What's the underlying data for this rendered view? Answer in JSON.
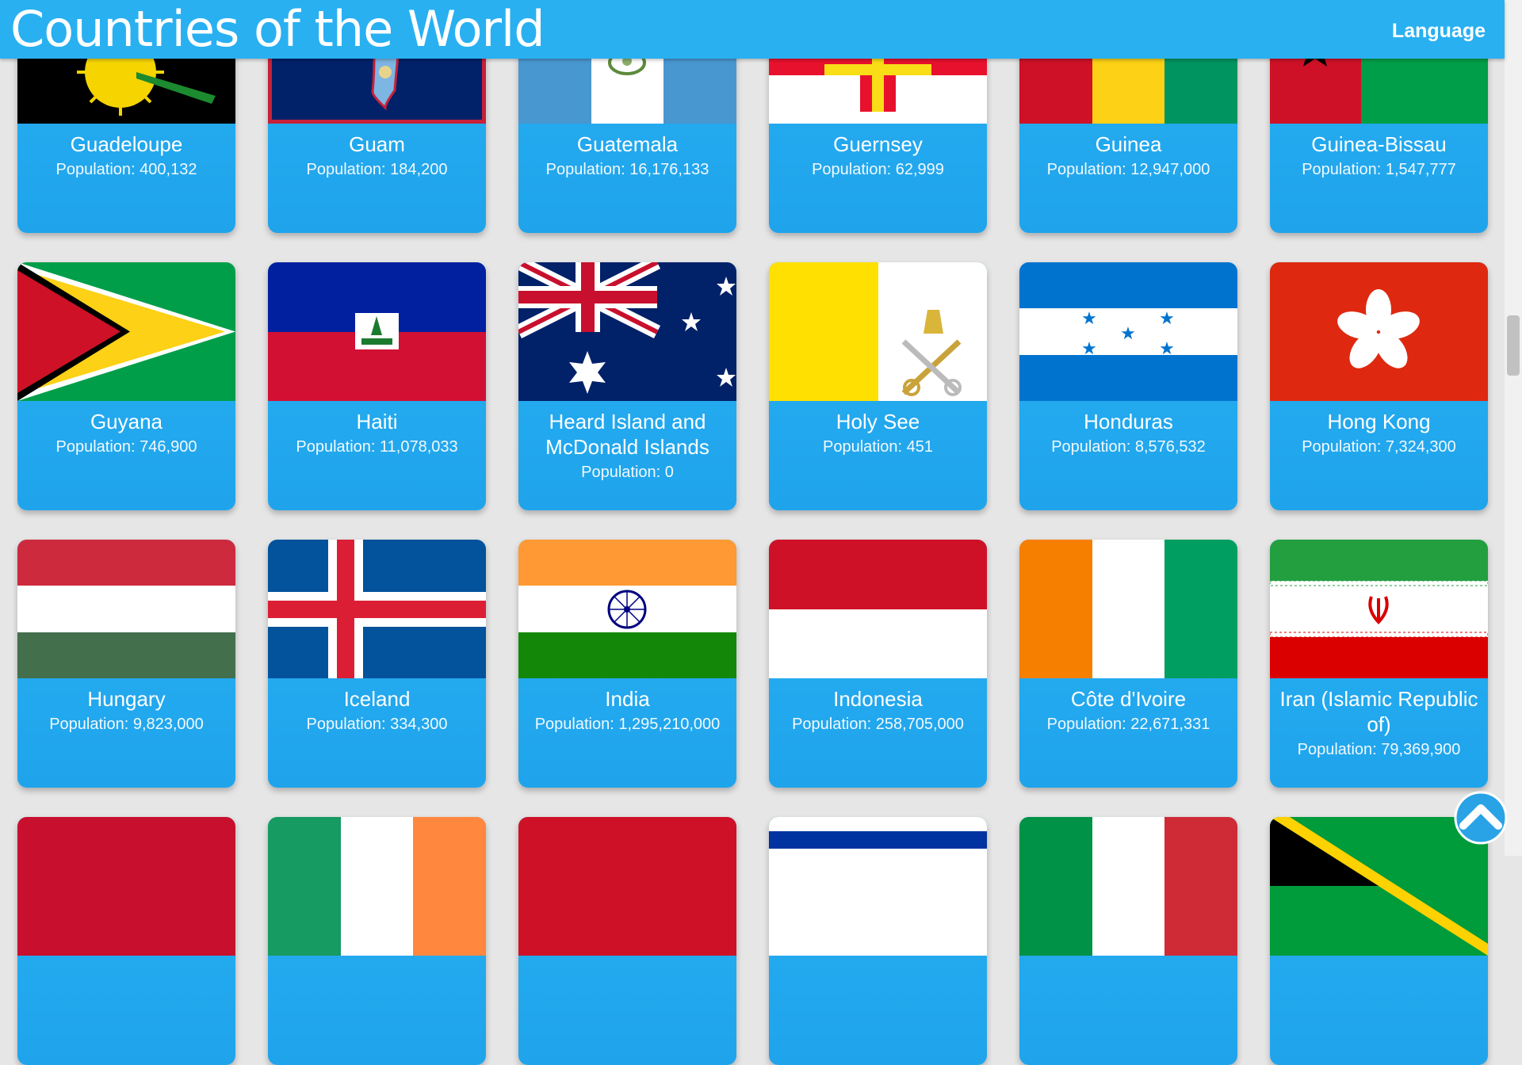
{
  "header": {
    "title": "Countries of the World",
    "language_label": "Language"
  },
  "colors": {
    "header": "#29b0f1",
    "card": "#29b0f1",
    "background": "#e6e6e6"
  },
  "countries": [
    {
      "name": "Guadeloupe",
      "population_label": "Population: 400,132"
    },
    {
      "name": "Guam",
      "population_label": "Population: 184,200"
    },
    {
      "name": "Guatemala",
      "population_label": "Population: 16,176,133"
    },
    {
      "name": "Guernsey",
      "population_label": "Population: 62,999"
    },
    {
      "name": "Guinea",
      "population_label": "Population: 12,947,000"
    },
    {
      "name": "Guinea-Bissau",
      "population_label": "Population: 1,547,777"
    },
    {
      "name": "Guyana",
      "population_label": "Population: 746,900"
    },
    {
      "name": "Haiti",
      "population_label": "Population: 11,078,033"
    },
    {
      "name": "Heard Island and McDonald Islands",
      "population_label": "Population: 0"
    },
    {
      "name": "Holy See",
      "population_label": "Population: 451"
    },
    {
      "name": "Honduras",
      "population_label": "Population: 8,576,532"
    },
    {
      "name": "Hong Kong",
      "population_label": "Population: 7,324,300"
    },
    {
      "name": "Hungary",
      "population_label": "Population: 9,823,000"
    },
    {
      "name": "Iceland",
      "population_label": "Population: 334,300"
    },
    {
      "name": "India",
      "population_label": "Population: 1,295,210,000"
    },
    {
      "name": "Indonesia",
      "population_label": "Population: 258,705,000"
    },
    {
      "name": "Côte d'Ivoire",
      "population_label": "Population: 22,671,331"
    },
    {
      "name": "Iran (Islamic Republic of)",
      "population_label": "Population: 79,369,900"
    }
  ],
  "scroll_top_icon": "chevron-up-icon"
}
